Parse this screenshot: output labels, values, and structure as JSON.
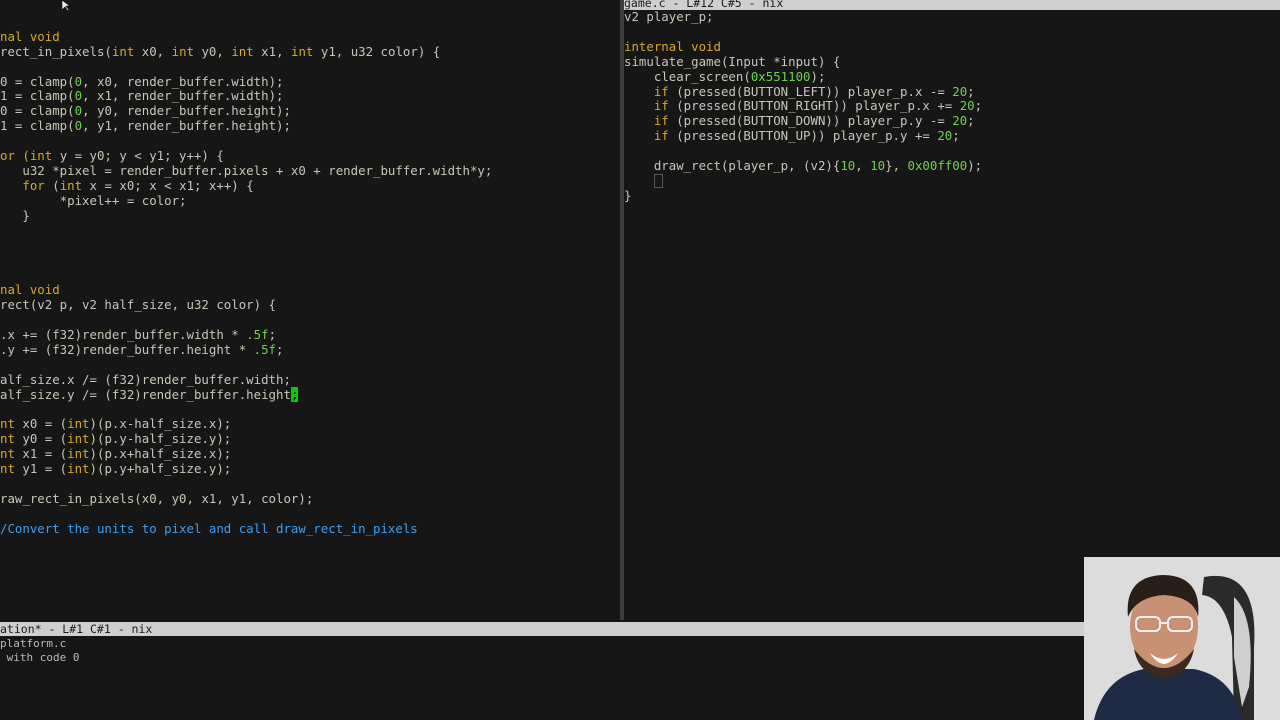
{
  "editor": {
    "left_pane": {
      "lines": [
        [],
        [],
        [
          {
            "t": "nal ",
            "c": "kw"
          },
          {
            "t": "void",
            "c": "kw"
          }
        ],
        [
          {
            "t": "rect_in_pixels("
          },
          {
            "t": "int",
            "c": "kw"
          },
          {
            "t": " x0, "
          },
          {
            "t": "int",
            "c": "kw"
          },
          {
            "t": " y0, "
          },
          {
            "t": "int",
            "c": "kw"
          },
          {
            "t": " x1, "
          },
          {
            "t": "int",
            "c": "kw"
          },
          {
            "t": " y1, u32 color) {"
          }
        ],
        [],
        [
          {
            "t": "0 = clamp("
          },
          {
            "t": "0",
            "c": "num"
          },
          {
            "t": ", x0, render_buffer.width);"
          }
        ],
        [
          {
            "t": "1 = clamp("
          },
          {
            "t": "0",
            "c": "num"
          },
          {
            "t": ", x1, render_buffer.width);"
          }
        ],
        [
          {
            "t": "0 = clamp("
          },
          {
            "t": "0",
            "c": "num"
          },
          {
            "t": ", y0, render_buffer.height);"
          }
        ],
        [
          {
            "t": "1 = clamp("
          },
          {
            "t": "0",
            "c": "num"
          },
          {
            "t": ", y1, render_buffer.height);"
          }
        ],
        [],
        [
          {
            "t": "or (",
            "c": "kw"
          },
          {
            "t": "int",
            "c": "kw"
          },
          {
            "t": " y = y0; y < y1; y++) {"
          }
        ],
        [
          {
            "t": "   u32 *pixel = render_buffer.pixels + x0 + render_buffer.width*y;"
          }
        ],
        [
          {
            "t": "   "
          },
          {
            "t": "for",
            "c": "kw"
          },
          {
            "t": " ("
          },
          {
            "t": "int",
            "c": "kw"
          },
          {
            "t": " x = x0; x < x1; x++) {"
          }
        ],
        [
          {
            "t": "        *pixel++ = color;"
          }
        ],
        [
          {
            "t": "   }"
          }
        ],
        [],
        [],
        [],
        [],
        [
          {
            "t": "nal ",
            "c": "kw"
          },
          {
            "t": "void",
            "c": "kw"
          }
        ],
        [
          {
            "t": "rect(v2 p, v2 half_size, u32 color) {"
          }
        ],
        [],
        [
          {
            "t": ".x += (f32)render_buffer.width * "
          },
          {
            "t": ".5f",
            "c": "num"
          },
          {
            "t": ";"
          }
        ],
        [
          {
            "t": ".y += (f32)render_buffer.height * "
          },
          {
            "t": ".5f",
            "c": "num"
          },
          {
            "t": ";"
          }
        ],
        [],
        [
          {
            "t": "alf_size.x /= (f32)render_buffer.width;"
          }
        ],
        [
          {
            "t": "alf_size.y /= (f32)render_buffer.height"
          },
          {
            "t": ";",
            "c": "cursor"
          }
        ],
        [],
        [
          {
            "t": "nt",
            "c": "kw"
          },
          {
            "t": " x0 = ("
          },
          {
            "t": "int",
            "c": "kw"
          },
          {
            "t": ")(p.x-half_size.x);"
          }
        ],
        [
          {
            "t": "nt",
            "c": "kw"
          },
          {
            "t": " y0 = ("
          },
          {
            "t": "int",
            "c": "kw"
          },
          {
            "t": ")(p.y-half_size.y);"
          }
        ],
        [
          {
            "t": "nt",
            "c": "kw"
          },
          {
            "t": " x1 = ("
          },
          {
            "t": "int",
            "c": "kw"
          },
          {
            "t": ")(p.x+half_size.x);"
          }
        ],
        [
          {
            "t": "nt",
            "c": "kw"
          },
          {
            "t": " y1 = ("
          },
          {
            "t": "int",
            "c": "kw"
          },
          {
            "t": ")(p.y+half_size.y);"
          }
        ],
        [],
        [
          {
            "t": "raw_rect_in_pixels(x0, y0, x1, y1, color);"
          }
        ],
        [],
        [
          {
            "t": "/Convert the units to pixel and call draw_rect_in_pixels",
            "c": "cm"
          }
        ]
      ]
    },
    "right_pane": {
      "modeline": "game.c - L#12 C#5 - nix",
      "lines": [
        [
          {
            "t": "v2 player_p;"
          }
        ],
        [],
        [
          {
            "t": "internal ",
            "c": "kw"
          },
          {
            "t": "void",
            "c": "kw"
          }
        ],
        [
          {
            "t": "simulate_game(Input *input) {"
          }
        ],
        [
          {
            "t": "    clear_screen("
          },
          {
            "t": "0x551100",
            "c": "num"
          },
          {
            "t": ");"
          }
        ],
        [
          {
            "t": "    "
          },
          {
            "t": "if",
            "c": "kw"
          },
          {
            "t": " (pressed(BUTTON_LEFT)) player_p.x -= "
          },
          {
            "t": "20",
            "c": "num"
          },
          {
            "t": ";"
          }
        ],
        [
          {
            "t": "    "
          },
          {
            "t": "if",
            "c": "kw"
          },
          {
            "t": " (pressed(BUTTON_RIGHT)) player_p.x += "
          },
          {
            "t": "20",
            "c": "num"
          },
          {
            "t": ";"
          }
        ],
        [
          {
            "t": "    "
          },
          {
            "t": "if",
            "c": "kw"
          },
          {
            "t": " (pressed(BUTTON_DOWN)) player_p.y -= "
          },
          {
            "t": "20",
            "c": "num"
          },
          {
            "t": ";"
          }
        ],
        [
          {
            "t": "    "
          },
          {
            "t": "if",
            "c": "kw"
          },
          {
            "t": " (pressed(BUTTON_UP)) player_p.y += "
          },
          {
            "t": "20",
            "c": "num"
          },
          {
            "t": ";"
          }
        ],
        [],
        [
          {
            "t": "    draw_rect(player_p, (v2){"
          },
          {
            "t": "10",
            "c": "num"
          },
          {
            "t": ", "
          },
          {
            "t": "10",
            "c": "num"
          },
          {
            "t": "}, "
          },
          {
            "t": "0x00ff00",
            "c": "num"
          },
          {
            "t": ");"
          }
        ],
        [
          {
            "t": "    "
          },
          {
            "t": "",
            "c": "hollow"
          }
        ],
        [
          {
            "t": "}"
          }
        ]
      ]
    },
    "bottom_modeline": "ation* - L#1 C#1 - nix",
    "minibuffer": [
      "platform.c",
      " with code 0"
    ]
  },
  "colors": {
    "background": "#161616",
    "keyword": "#d8a824",
    "number": "#6dd34a",
    "comment": "#3c9ef0",
    "text": "#c9c5b7",
    "cursor": "#00d000",
    "modeline": "#cfcfcf"
  },
  "overlays": {
    "webcam": "webcam-overlay",
    "pointer": "mouse-pointer-icon"
  }
}
